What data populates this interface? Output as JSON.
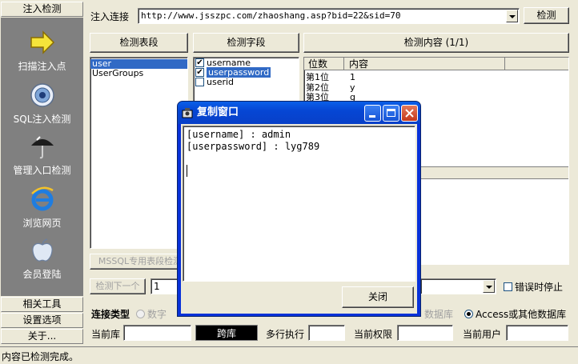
{
  "sidebar": {
    "header_inject": "注入检测",
    "items": [
      {
        "label": "扫描注入点",
        "icon": "arrow-right-icon"
      },
      {
        "label": "SQL注入检测",
        "icon": "target-icon"
      },
      {
        "label": "管理入口检测",
        "icon": "umbrella-icon"
      },
      {
        "label": "浏览网页",
        "icon": "ie-icon"
      },
      {
        "label": "会员登陆",
        "icon": "apple-icon"
      }
    ],
    "footer_tools": "相关工具",
    "footer_settings": "设置选项",
    "footer_about": "关于..."
  },
  "url_bar": {
    "label": "注入连接",
    "value": "http://www.jsszpc.com/zhaoshang.asp?bid=22&sid=70",
    "detect_button": "检测"
  },
  "tables_panel": {
    "header": "检测表段",
    "items": [
      "user",
      "UserGroups"
    ],
    "selected_index": 0
  },
  "fields_panel": {
    "header": "检测字段",
    "items": [
      {
        "name": "username",
        "checked": true
      },
      {
        "name": "userpassword",
        "checked": true
      },
      {
        "name": "userid",
        "checked": false
      }
    ],
    "selected_index": 1
  },
  "content_panel": {
    "header": "检测内容 (1/1)",
    "col_position": "位数",
    "col_content": "内容",
    "rows": [
      {
        "pos": "第1位",
        "val": "1"
      },
      {
        "pos": "第2位",
        "val": "y"
      },
      {
        "pos": "第3位",
        "val": "g"
      }
    ]
  },
  "mssql_button": "MSSQL专用表段检测",
  "detect_next_button": "检测下一个",
  "detect_next_value": "1",
  "stop_on_error_label": "错误时停止",
  "conn_type": {
    "label": "连接类型",
    "opt_number": "数字",
    "opt_db": "数据库",
    "opt_access": "Access或其他数据库"
  },
  "info_row": {
    "current_db_label": "当前库",
    "current_db_value": "",
    "cross_db_button": "跨库",
    "multiline_label": "多行执行",
    "multiline_value": "",
    "privilege_label": "当前权限",
    "privilege_value": "",
    "user_label": "当前用户",
    "user_value": ""
  },
  "dialog": {
    "title": "复制窗口",
    "line1": "[username] : admin",
    "line2": "[userpassword] : lyg789",
    "close_button": "关闭"
  },
  "status": "内容已检测完成。",
  "colors": {
    "selection": "#316ac5",
    "sidebar_panel": "#808080",
    "dialog_title": "#0646d4"
  }
}
